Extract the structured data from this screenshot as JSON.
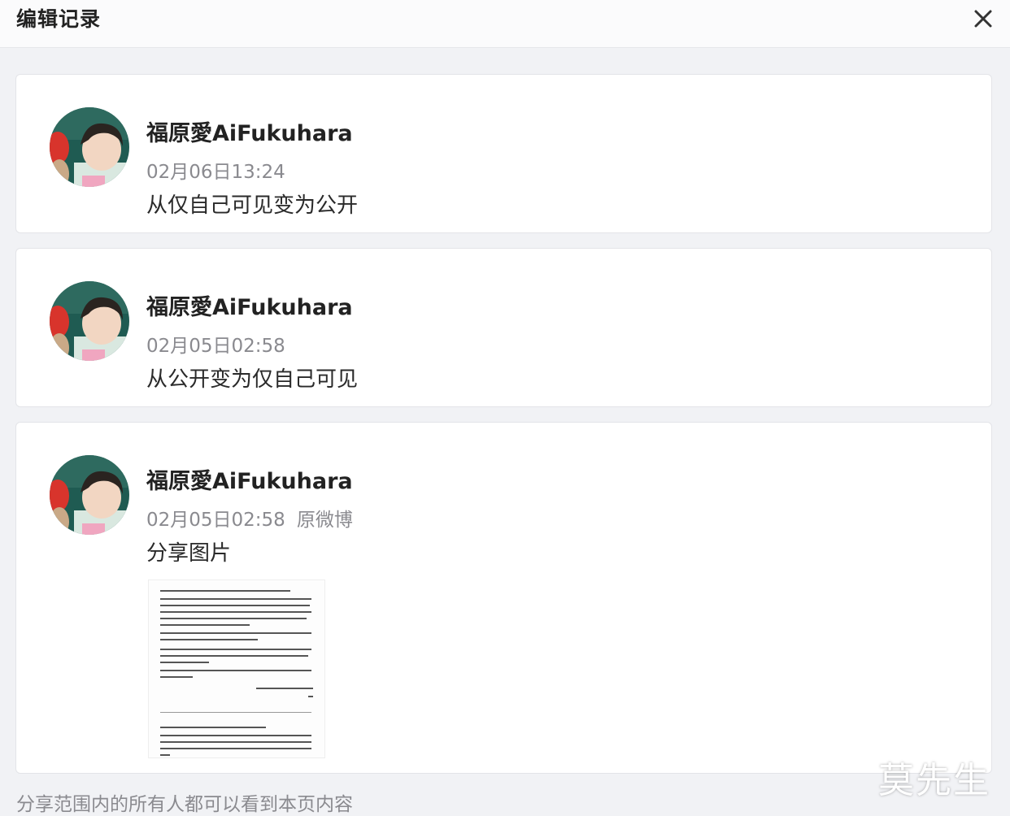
{
  "header": {
    "title": "编辑记录",
    "close_icon": "close-icon"
  },
  "records": [
    {
      "author": "福原愛AiFukuhara",
      "time": "02月06日13:24",
      "source": "",
      "content": "从仅自己可见变为公开"
    },
    {
      "author": "福原愛AiFukuhara",
      "time": "02月05日02:58",
      "source": "",
      "content": "从公开变为仅自己可见"
    },
    {
      "author": "福原愛AiFukuhara",
      "time": "02月05日02:58",
      "source": "原微博",
      "content": "分享图片",
      "has_image": true
    }
  ],
  "footer": {
    "text": "分享范围内的所有人都可以看到本页内容"
  },
  "watermark": {
    "text": "莫先生"
  },
  "colors": {
    "background": "#f1f2f5",
    "card": "#ffffff",
    "meta_text": "#8a8a8f"
  }
}
